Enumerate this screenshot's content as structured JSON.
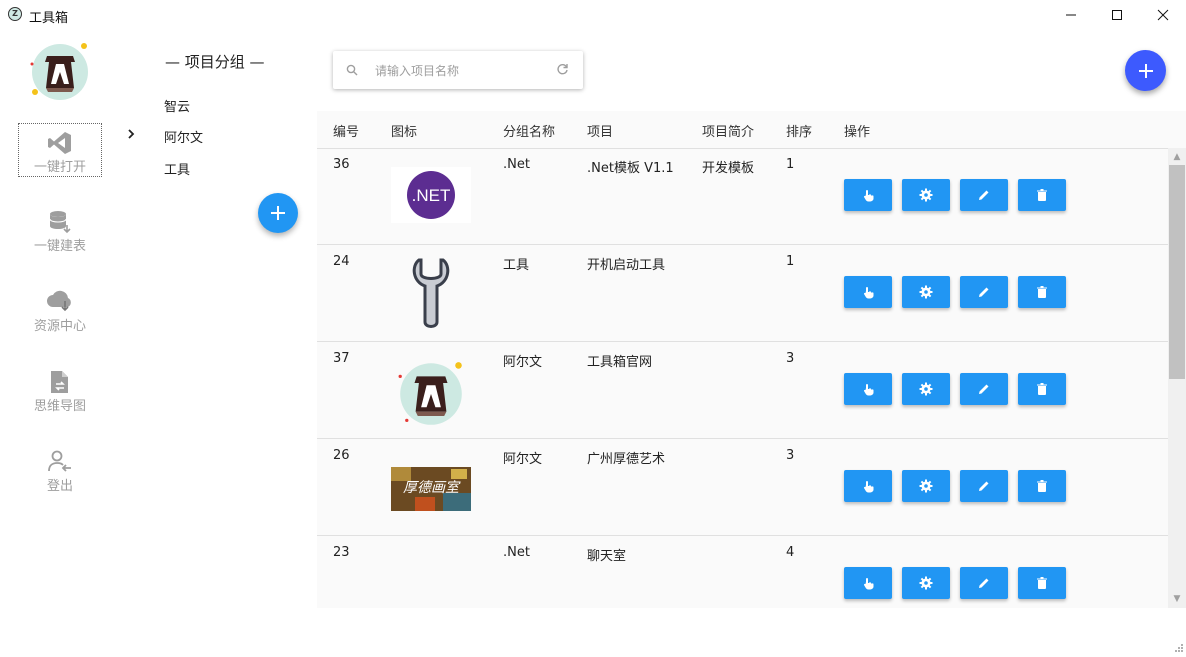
{
  "window": {
    "title": "工具箱"
  },
  "nav": {
    "items": [
      {
        "label": "一键打开",
        "icon": "vscode-icon"
      },
      {
        "label": "一键建表",
        "icon": "database-icon"
      },
      {
        "label": "资源中心",
        "icon": "cloud-download-icon"
      },
      {
        "label": "思维导图",
        "icon": "file-sync-icon"
      },
      {
        "label": "登出",
        "icon": "user-logout-icon"
      }
    ]
  },
  "groups": {
    "heading": "— 项目分组 —",
    "items": [
      "智云",
      "阿尔文",
      "工具"
    ],
    "selected_index": 1
  },
  "search": {
    "placeholder": "请输入项目名称",
    "value": ""
  },
  "table": {
    "headers": [
      "编号",
      "图标",
      "分组名称",
      "项目",
      "项目简介",
      "排序",
      "操作"
    ],
    "rows": [
      {
        "id": "36",
        "icon": "dotnet-logo",
        "icon_text": ".NET",
        "group": ".Net",
        "project": ".Net模板 V1.1",
        "desc": "开发模板",
        "order": "1"
      },
      {
        "id": "24",
        "icon": "wrench-logo",
        "group": "工具",
        "project": "开机启动工具",
        "desc": "",
        "order": "1"
      },
      {
        "id": "37",
        "icon": "alvin-avatar-logo",
        "group": "阿尔文",
        "project": "工具箱官网",
        "desc": "",
        "order": "3"
      },
      {
        "id": "26",
        "icon": "houde-studio-logo",
        "icon_text": "厚德画室",
        "group": "阿尔文",
        "project": "广州厚德艺术",
        "desc": "",
        "order": "3"
      },
      {
        "id": "23",
        "icon": "",
        "group": ".Net",
        "project": "聊天室",
        "desc": "",
        "order": "4"
      }
    ]
  },
  "colors": {
    "primary": "#2196f3",
    "fab_accent": "#3d5afe",
    "table_bg": "#fafafa"
  }
}
